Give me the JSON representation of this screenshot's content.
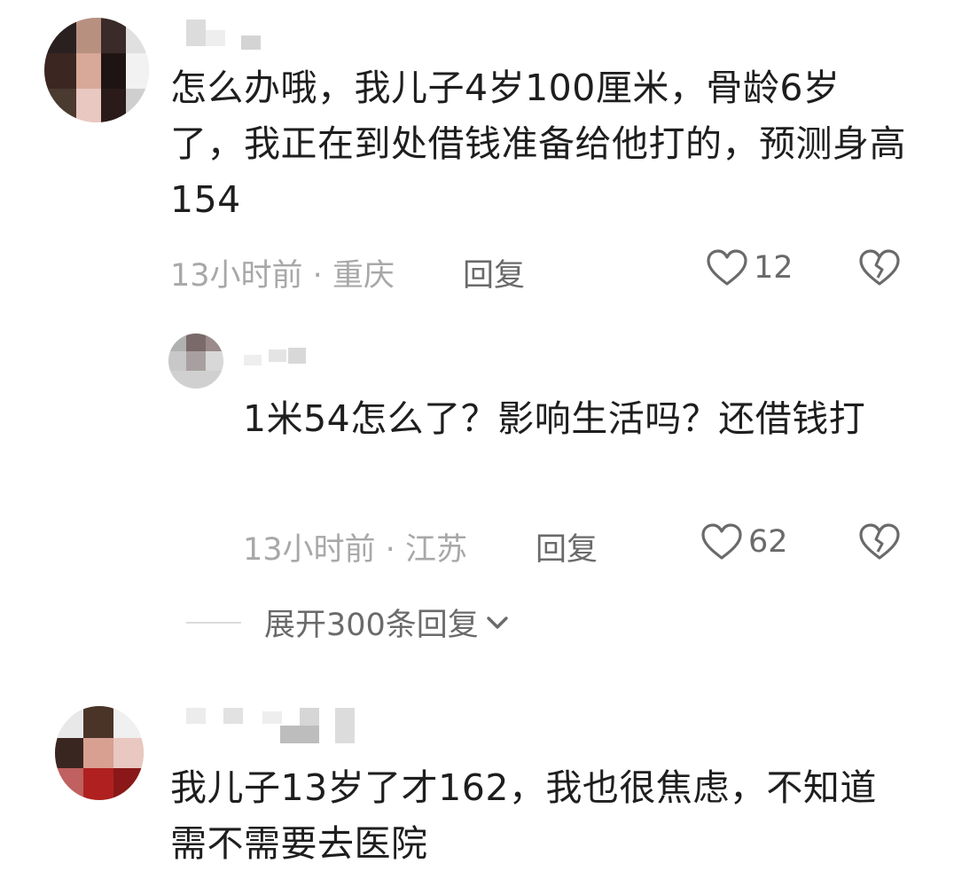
{
  "comments": [
    {
      "text": "怎么办哦，我儿子4岁100厘米，骨龄6岁了，我正在到处借钱准备给他打的，预测身高154",
      "time": "13小时前",
      "location": "重庆",
      "reply_label": "回复",
      "likes": "12"
    },
    {
      "text": "1米54怎么了？影响生活吗？还借钱打",
      "time": "13小时前",
      "location": "江苏",
      "reply_label": "回复",
      "likes": "62"
    },
    {
      "text": "我儿子13岁了才162，我也很焦虑，不知道需不需要去医院"
    }
  ],
  "expand_replies": "展开300条回复",
  "meta_separator": " · ",
  "icons": {
    "like": "heart-outline-icon",
    "dislike": "broken-heart-icon",
    "expand": "chevron-down-icon"
  },
  "colors": {
    "text": "#1e1e1e",
    "meta": "#a8a8a8",
    "action": "#6a6a6a"
  }
}
